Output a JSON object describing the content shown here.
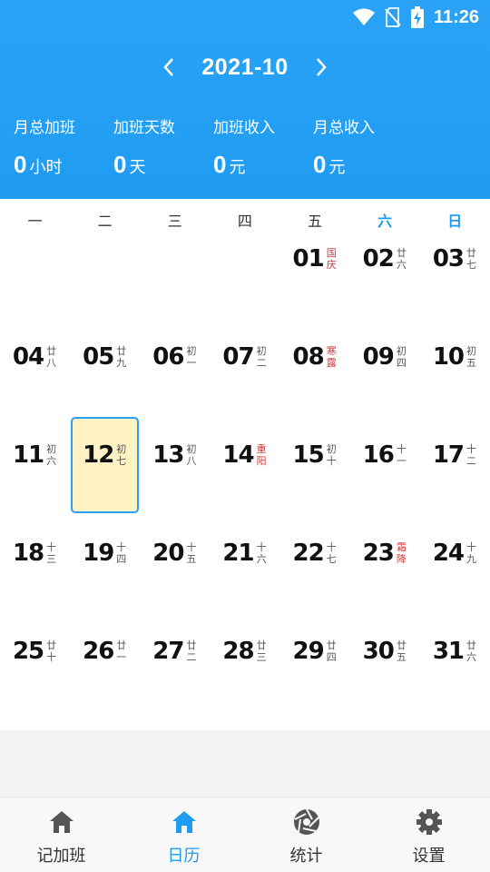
{
  "status": {
    "time": "11:26"
  },
  "header": {
    "month": "2021-10",
    "stats": [
      {
        "label": "月总加班",
        "value": "0",
        "unit": "小时"
      },
      {
        "label": "加班天数",
        "value": "0",
        "unit": "天"
      },
      {
        "label": "加班收入",
        "value": "0",
        "unit": "元"
      },
      {
        "label": "月总收入",
        "value": "0",
        "unit": "元"
      }
    ]
  },
  "calendar": {
    "weekdays": [
      "一",
      "二",
      "三",
      "四",
      "五",
      "六",
      "日"
    ],
    "days": [
      {
        "num": "01",
        "lunar": "国庆",
        "holiday": true
      },
      {
        "num": "02",
        "lunar": "廿六"
      },
      {
        "num": "03",
        "lunar": "廿七"
      },
      {
        "num": "04",
        "lunar": "廿八"
      },
      {
        "num": "05",
        "lunar": "廿九"
      },
      {
        "num": "06",
        "lunar": "初一"
      },
      {
        "num": "07",
        "lunar": "初二"
      },
      {
        "num": "08",
        "lunar": "寒露",
        "holiday": true
      },
      {
        "num": "09",
        "lunar": "初四"
      },
      {
        "num": "10",
        "lunar": "初五"
      },
      {
        "num": "11",
        "lunar": "初六"
      },
      {
        "num": "12",
        "lunar": "初七",
        "selected": true
      },
      {
        "num": "13",
        "lunar": "初八"
      },
      {
        "num": "14",
        "lunar": "重阳",
        "holiday": true
      },
      {
        "num": "15",
        "lunar": "初十"
      },
      {
        "num": "16",
        "lunar": "十一"
      },
      {
        "num": "17",
        "lunar": "十二"
      },
      {
        "num": "18",
        "lunar": "十三"
      },
      {
        "num": "19",
        "lunar": "十四"
      },
      {
        "num": "20",
        "lunar": "十五"
      },
      {
        "num": "21",
        "lunar": "十六"
      },
      {
        "num": "22",
        "lunar": "十七"
      },
      {
        "num": "23",
        "lunar": "霜降",
        "holiday": true
      },
      {
        "num": "24",
        "lunar": "十九"
      },
      {
        "num": "25",
        "lunar": "廿十"
      },
      {
        "num": "26",
        "lunar": "廿一"
      },
      {
        "num": "27",
        "lunar": "廿二"
      },
      {
        "num": "28",
        "lunar": "廿三"
      },
      {
        "num": "29",
        "lunar": "廿四"
      },
      {
        "num": "30",
        "lunar": "廿五"
      },
      {
        "num": "31",
        "lunar": "廿六"
      }
    ]
  },
  "nav": {
    "tabs": [
      {
        "label": "记加班",
        "icon": "home-icon"
      },
      {
        "label": "日历",
        "icon": "home-icon",
        "active": true
      },
      {
        "label": "统计",
        "icon": "aperture-icon"
      },
      {
        "label": "设置",
        "icon": "gear-icon"
      }
    ]
  },
  "colors": {
    "accent": "#1f9cf2",
    "holiday": "#d23a3a",
    "selected_bg": "#fff2c4"
  }
}
